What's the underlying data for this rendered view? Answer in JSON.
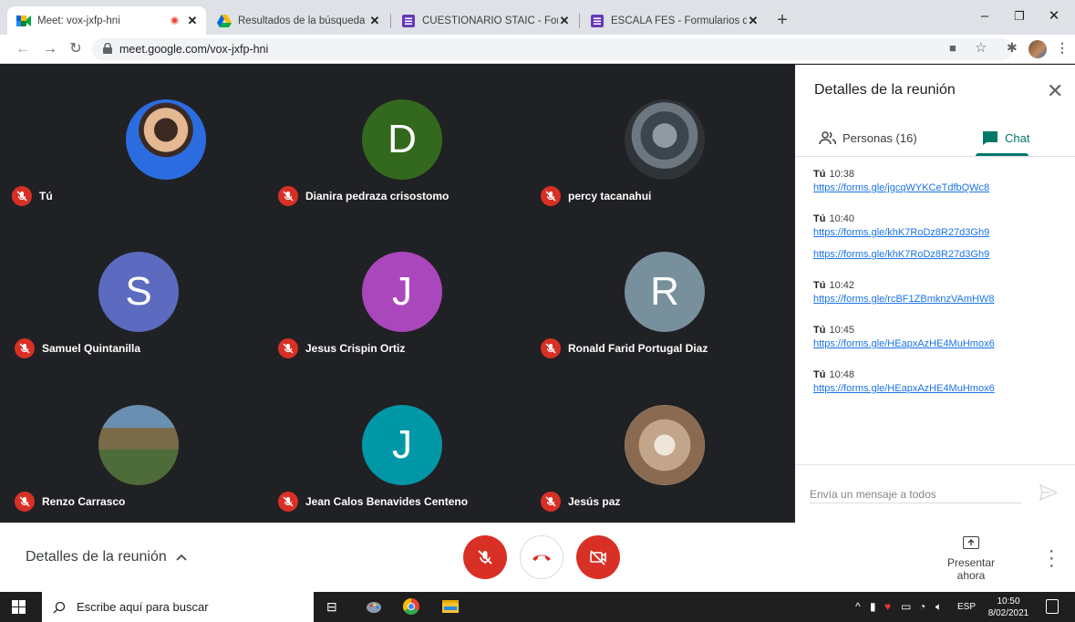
{
  "browser": {
    "tabs": [
      {
        "title": "Meet: vox-jxfp-hni",
        "active": true,
        "favicon": "meet-icon",
        "recording": true
      },
      {
        "title": "Resultados de la búsqueda - Goo",
        "active": false,
        "favicon": "drive-icon"
      },
      {
        "title": "CUESTIONARIO STAIC - Formular",
        "active": false,
        "favicon": "forms-icon"
      },
      {
        "title": "ESCALA FES - Formularios de Go",
        "active": false,
        "favicon": "forms-icon"
      }
    ],
    "url": "meet.google.com/vox-jxfp-hni"
  },
  "participants": [
    {
      "name": "Tú",
      "avatar": "photo",
      "color": "#c9d6e8"
    },
    {
      "name": "Dianira pedraza crisostomo",
      "avatar": "D",
      "color": "#33691e"
    },
    {
      "name": "percy tacanahui",
      "avatar": "photo",
      "color": "#5a6670"
    },
    {
      "name": "Samuel Quintanilla",
      "avatar": "S",
      "color": "#5c6bc0"
    },
    {
      "name": "Jesus Crispin Ortiz",
      "avatar": "J",
      "color": "#ab47bc"
    },
    {
      "name": "Ronald Farid Portugal Diaz",
      "avatar": "R",
      "color": "#78909c"
    },
    {
      "name": "Renzo Carrasco",
      "avatar": "photo",
      "color": "#4e6b3a"
    },
    {
      "name": "Jean Calos Benavides Centeno",
      "avatar": "J",
      "color": "#0097a7"
    },
    {
      "name": "Jesús paz",
      "avatar": "photo",
      "color": "#c2a58a"
    }
  ],
  "panel": {
    "title": "Detalles de la reunión",
    "people_tab": "Personas (16)",
    "chat_tab": "Chat",
    "messages": [
      {
        "author": "Tú",
        "time": "10:38",
        "links": [
          "https://forms.gle/jgcqWYKCeTdfbQWc8"
        ]
      },
      {
        "author": "Tú",
        "time": "10:40",
        "links": [
          "https://forms.gle/khK7RoDz8R27d3Gh9",
          "https://forms.gle/khK7RoDz8R27d3Gh9"
        ]
      },
      {
        "author": "Tú",
        "time": "10:42",
        "links": [
          "https://forms.gle/rcBF1ZBmknzVAmHW8"
        ]
      },
      {
        "author": "Tú",
        "time": "10:45",
        "links": [
          "https://forms.gle/HEapxAzHE4MuHmox6"
        ]
      },
      {
        "author": "Tú",
        "time": "10:48",
        "links": [
          "https://forms.gle/HEapxAzHE4MuHmox6"
        ]
      }
    ],
    "composer_placeholder": "Envía un mensaje a todos"
  },
  "bottom": {
    "details": "Detalles de la reunión",
    "present": "Presentar ahora"
  },
  "taskbar": {
    "search_placeholder": "Escribe aquí para buscar",
    "lang": "ESP",
    "time": "10:50",
    "date": "8/02/2021"
  }
}
